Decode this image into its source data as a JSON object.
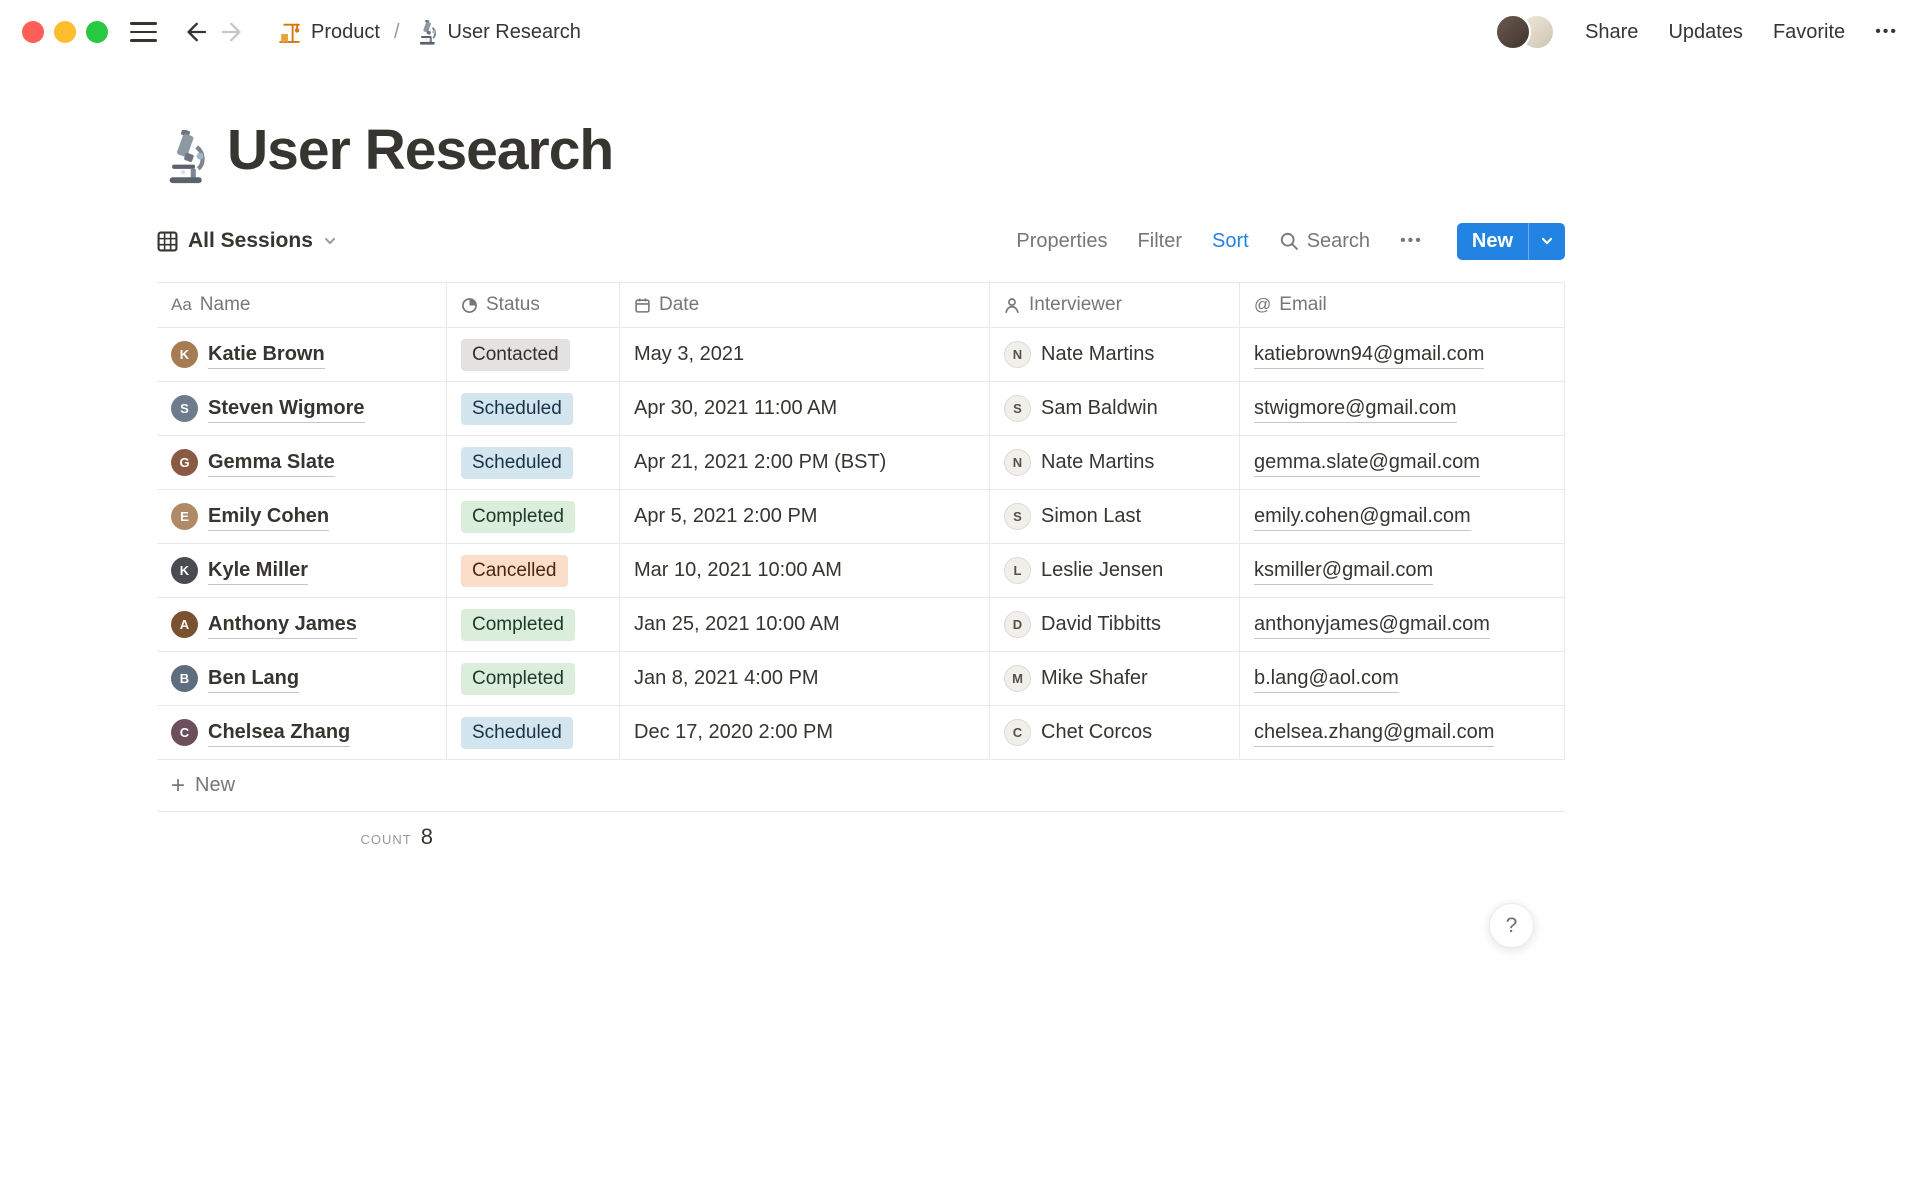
{
  "topbar": {
    "breadcrumb": {
      "product_label": "Product",
      "separator": "/",
      "page_label": "User Research"
    },
    "actions": {
      "share": "Share",
      "updates": "Updates",
      "favorite": "Favorite",
      "more": "•••"
    }
  },
  "page": {
    "title": "User Research"
  },
  "view_bar": {
    "view_name": "All Sessions",
    "properties": "Properties",
    "filter": "Filter",
    "sort": "Sort",
    "search": "Search",
    "more": "•••",
    "new_label": "New"
  },
  "table": {
    "columns": [
      {
        "icon": "text-icon",
        "label": "Name"
      },
      {
        "icon": "status-icon",
        "label": "Status"
      },
      {
        "icon": "calendar-icon",
        "label": "Date"
      },
      {
        "icon": "person-icon",
        "label": "Interviewer"
      },
      {
        "icon": "at-icon",
        "label": "Email"
      }
    ],
    "rows": [
      {
        "name": "Katie Brown",
        "avatar": {
          "initial": "K",
          "color": "#a67c52"
        },
        "status": {
          "label": "Contacted",
          "bg": "#e3e2e0",
          "fg": "#32302c"
        },
        "date": "May 3, 2021",
        "interviewer": {
          "name": "Nate Martins",
          "initial": "N"
        },
        "email": "katiebrown94@gmail.com"
      },
      {
        "name": "Steven Wigmore",
        "avatar": {
          "initial": "S",
          "color": "#6e7b8a"
        },
        "status": {
          "label": "Scheduled",
          "bg": "#d3e5ef",
          "fg": "#183347"
        },
        "date": "Apr 30, 2021 11:00 AM",
        "interviewer": {
          "name": "Sam Baldwin",
          "initial": "S"
        },
        "email": "stwigmore@gmail.com"
      },
      {
        "name": "Gemma Slate",
        "avatar": {
          "initial": "G",
          "color": "#8a5a44"
        },
        "status": {
          "label": "Scheduled",
          "bg": "#d3e5ef",
          "fg": "#183347"
        },
        "date": "Apr 21, 2021 2:00 PM (BST)",
        "interviewer": {
          "name": "Nate Martins",
          "initial": "N"
        },
        "email": "gemma.slate@gmail.com"
      },
      {
        "name": "Emily Cohen",
        "avatar": {
          "initial": "E",
          "color": "#b08a66"
        },
        "status": {
          "label": "Completed",
          "bg": "#dbeddb",
          "fg": "#1c3829"
        },
        "date": "Apr 5, 2021 2:00 PM",
        "interviewer": {
          "name": "Simon Last",
          "initial": "S"
        },
        "email": "emily.cohen@gmail.com"
      },
      {
        "name": "Kyle Miller",
        "avatar": {
          "initial": "K",
          "color": "#4a4a52"
        },
        "status": {
          "label": "Cancelled",
          "bg": "#fadec9",
          "fg": "#49290e"
        },
        "date": "Mar 10, 2021 10:00 AM",
        "interviewer": {
          "name": "Leslie Jensen",
          "initial": "L"
        },
        "email": "ksmiller@gmail.com"
      },
      {
        "name": "Anthony James",
        "avatar": {
          "initial": "A",
          "color": "#7a5230"
        },
        "status": {
          "label": "Completed",
          "bg": "#dbeddb",
          "fg": "#1c3829"
        },
        "date": "Jan 25, 2021 10:00 AM",
        "interviewer": {
          "name": "David Tibbitts",
          "initial": "D"
        },
        "email": "anthonyjames@gmail.com"
      },
      {
        "name": "Ben Lang",
        "avatar": {
          "initial": "B",
          "color": "#5f6e7e"
        },
        "status": {
          "label": "Completed",
          "bg": "#dbeddb",
          "fg": "#1c3829"
        },
        "date": "Jan 8, 2021 4:00 PM",
        "interviewer": {
          "name": "Mike Shafer",
          "initial": "M"
        },
        "email": "b.lang@aol.com"
      },
      {
        "name": "Chelsea Zhang",
        "avatar": {
          "initial": "C",
          "color": "#6b4f5b"
        },
        "status": {
          "label": "Scheduled",
          "bg": "#d3e5ef",
          "fg": "#183347"
        },
        "date": "Dec 17, 2020 2:00 PM",
        "interviewer": {
          "name": "Chet Corcos",
          "initial": "C"
        },
        "email": "chelsea.zhang@gmail.com"
      }
    ],
    "new_row_label": "New",
    "count_label": "COUNT",
    "count_value": "8"
  },
  "help": {
    "label": "?"
  },
  "colors": {
    "accent": "#2383e2",
    "status_contacted_bg": "#e3e2e0",
    "status_scheduled_bg": "#d3e5ef",
    "status_completed_bg": "#dbeddb",
    "status_cancelled_bg": "#fadec9",
    "border": "#e9e9e7"
  }
}
